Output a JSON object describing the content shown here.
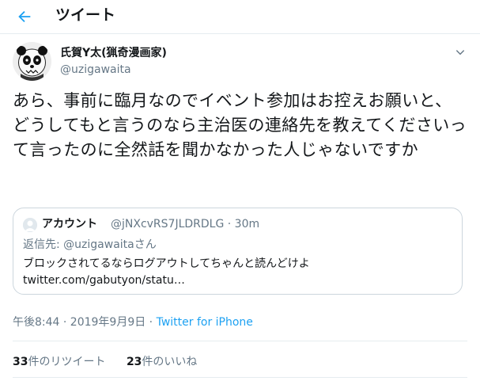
{
  "header": {
    "title": "ツイート",
    "back_icon": "arrow-left-icon"
  },
  "author": {
    "display_name": "氏賀Y太(猟奇漫画家)",
    "handle": "@uzigawaita",
    "avatar": "panda-avatar"
  },
  "tweet": {
    "text": "あら、事前に臨月なのでイベント参加はお控えお願いと、どうしてもと言うのなら主治医の連絡先を教えてくださいって言ったのに全然話を聞かなかった人じゃないですか"
  },
  "quote": {
    "name": "アカウント",
    "handle": "@jNXcvRS7JLDRDLG · 30m",
    "reply_prefix": "返信先: ",
    "reply_mention": "@uzigawaita",
    "reply_suffix": "さん",
    "text": "ブロックされてるならログアウトしてちゃんと読んどけよtwitter.com/gabutyon/statu…"
  },
  "meta": {
    "timestamp": "午後8:44 · 2019年9月9日 · ",
    "source": "Twitter for iPhone"
  },
  "stats": {
    "retweets_count": "33",
    "retweets_label": "件のリツイート",
    "likes_count": "23",
    "likes_label": "件のいいね"
  },
  "colors": {
    "accent": "#1da1f2",
    "secondary_text": "#657786",
    "border": "#e6ecf0"
  }
}
